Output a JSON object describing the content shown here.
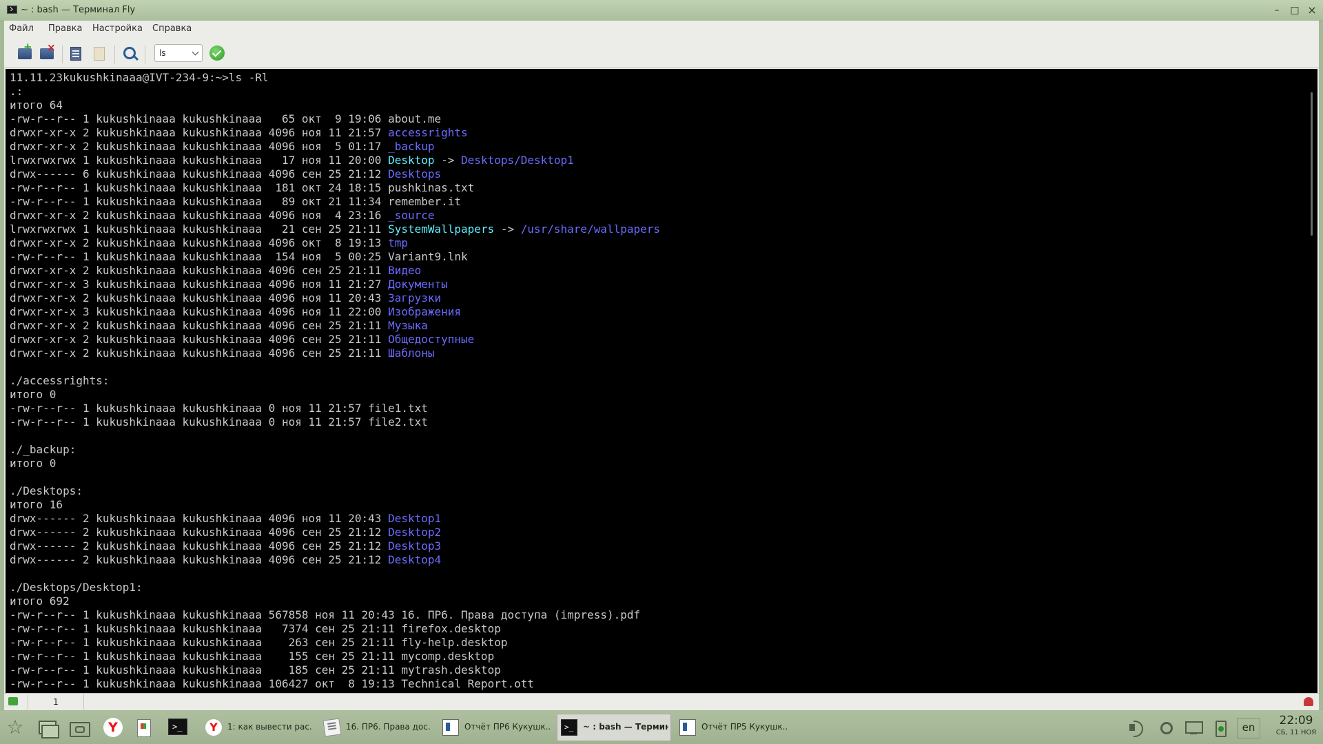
{
  "window": {
    "title": "~ : bash — Терминал Fly"
  },
  "menu": [
    "Файл",
    "Правка",
    "Настройка",
    "Справка"
  ],
  "toolbar": {
    "command_select": "ls"
  },
  "terminal": {
    "lines": [
      [
        "11.11.23kukushkinaaa@IVT-234-9:~>ls -Rl"
      ],
      [
        ".:"
      ],
      [
        "итого 64"
      ],
      [
        "-rw-r--r-- 1 kukushkinaaa kukushkinaaa   65 окт  9 19:06 about.me"
      ],
      [
        "drwxr-xr-x 2 kukushkinaaa kukushkinaaa 4096 ноя 11 21:57 ",
        "b:accessrights"
      ],
      [
        "drwxr-xr-x 2 kukushkinaaa kukushkinaaa 4096 ноя  5 01:17 ",
        "b:_backup"
      ],
      [
        "lrwxrwxrwx 1 kukushkinaaa kukushkinaaa   17 ноя 11 20:00 ",
        "c:Desktop",
        " -> ",
        "b:Desktops/Desktop1"
      ],
      [
        "drwx------ 6 kukushkinaaa kukushkinaaa 4096 сен 25 21:12 ",
        "b:Desktops"
      ],
      [
        "-rw-r--r-- 1 kukushkinaaa kukushkinaaa  181 окт 24 18:15 pushkinas.txt"
      ],
      [
        "-rw-r--r-- 1 kukushkinaaa kukushkinaaa   89 окт 21 11:34 remember.it"
      ],
      [
        "drwxr-xr-x 2 kukushkinaaa kukushkinaaa 4096 ноя  4 23:16 ",
        "b:_source"
      ],
      [
        "lrwxrwxrwx 1 kukushkinaaa kukushkinaaa   21 сен 25 21:11 ",
        "c:SystemWallpapers",
        " -> ",
        "b:/usr/share/wallpapers"
      ],
      [
        "drwxr-xr-x 2 kukushkinaaa kukushkinaaa 4096 окт  8 19:13 ",
        "b:tmp"
      ],
      [
        "-rw-r--r-- 1 kukushkinaaa kukushkinaaa  154 ноя  5 00:25 Variant9.lnk"
      ],
      [
        "drwxr-xr-x 2 kukushkinaaa kukushkinaaa 4096 сен 25 21:11 ",
        "b:Видео"
      ],
      [
        "drwxr-xr-x 3 kukushkinaaa kukushkinaaa 4096 ноя 11 21:27 ",
        "b:Документы"
      ],
      [
        "drwxr-xr-x 2 kukushkinaaa kukushkinaaa 4096 ноя 11 20:43 ",
        "b:Загрузки"
      ],
      [
        "drwxr-xr-x 3 kukushkinaaa kukushkinaaa 4096 ноя 11 22:00 ",
        "b:Изображения"
      ],
      [
        "drwxr-xr-x 2 kukushkinaaa kukushkinaaa 4096 сен 25 21:11 ",
        "b:Музыка"
      ],
      [
        "drwxr-xr-x 2 kukushkinaaa kukushkinaaa 4096 сен 25 21:11 ",
        "b:Общедоступные"
      ],
      [
        "drwxr-xr-x 2 kukushkinaaa kukushkinaaa 4096 сен 25 21:11 ",
        "b:Шаблоны"
      ],
      [
        ""
      ],
      [
        "./accessrights:"
      ],
      [
        "итого 0"
      ],
      [
        "-rw-r--r-- 1 kukushkinaaa kukushkinaaa 0 ноя 11 21:57 file1.txt"
      ],
      [
        "-rw-r--r-- 1 kukushkinaaa kukushkinaaa 0 ноя 11 21:57 file2.txt"
      ],
      [
        ""
      ],
      [
        "./_backup:"
      ],
      [
        "итого 0"
      ],
      [
        ""
      ],
      [
        "./Desktops:"
      ],
      [
        "итого 16"
      ],
      [
        "drwx------ 2 kukushkinaaa kukushkinaaa 4096 ноя 11 20:43 ",
        "b:Desktop1"
      ],
      [
        "drwx------ 2 kukushkinaaa kukushkinaaa 4096 сен 25 21:12 ",
        "b:Desktop2"
      ],
      [
        "drwx------ 2 kukushkinaaa kukushkinaaa 4096 сен 25 21:12 ",
        "b:Desktop3"
      ],
      [
        "drwx------ 2 kukushkinaaa kukushkinaaa 4096 сен 25 21:12 ",
        "b:Desktop4"
      ],
      [
        ""
      ],
      [
        "./Desktops/Desktop1:"
      ],
      [
        "итого 692"
      ],
      [
        "-rw-r--r-- 1 kukushkinaaa kukushkinaaa 567858 ноя 11 20:43 16. ПР6. Права доступа (impress).pdf"
      ],
      [
        "-rw-r--r-- 1 kukushkinaaa kukushkinaaa   7374 сен 25 21:11 firefox.desktop"
      ],
      [
        "-rw-r--r-- 1 kukushkinaaa kukushkinaaa    263 сен 25 21:11 fly-help.desktop"
      ],
      [
        "-rw-r--r-- 1 kukushkinaaa kukushkinaaa    155 сен 25 21:11 mycomp.desktop"
      ],
      [
        "-rw-r--r-- 1 kukushkinaaa kukushkinaaa    185 сен 25 21:11 mytrash.desktop"
      ],
      [
        "-rw-r--r-- 1 kukushkinaaa kukushkinaaa 106427 окт  8 19:13 Technical Report.ott"
      ]
    ]
  },
  "status": {
    "tab_label": "1"
  },
  "taskbar": {
    "tasks": [
      {
        "label": "1: как вывести рас...",
        "icon": "yandex-browser-icon",
        "active": false
      },
      {
        "label": "16. ПР6. Права дос...",
        "icon": "pdf-viewer-icon",
        "active": false
      },
      {
        "label": "Отчёт ПР6 Кукушк...",
        "icon": "document-icon",
        "active": false
      },
      {
        "label": "~ : bash — Термин...",
        "icon": "terminal-icon",
        "active": true
      },
      {
        "label": "Отчёт ПР5 Кукушк...",
        "icon": "document-icon",
        "active": false
      }
    ],
    "language": "en",
    "clock_time": "22:09",
    "clock_date": "СБ, 11 НОЯ"
  }
}
